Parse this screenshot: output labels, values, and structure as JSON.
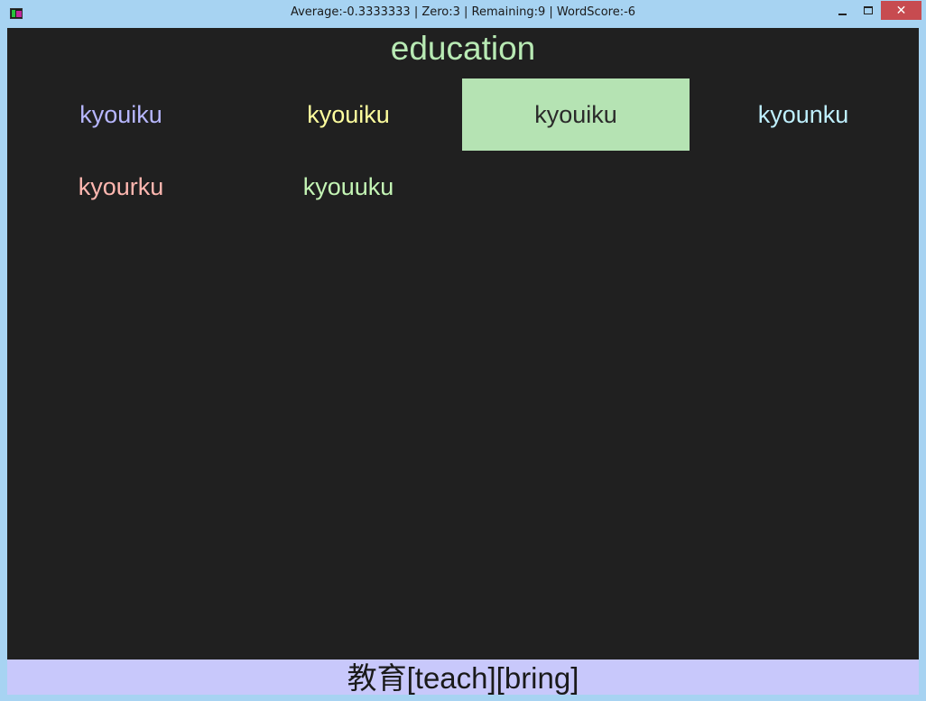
{
  "window": {
    "title": "Average:-0.3333333 | Zero:3 | Remaining:9 | WordScore:-6",
    "close_symbol": "✕"
  },
  "quiz": {
    "prompt": "education",
    "choices": [
      {
        "label": "kyouiku",
        "color": "#b7b7ff"
      },
      {
        "label": "kyouiku",
        "color": "#ffff9e"
      },
      {
        "label": "kyouiku",
        "color": "#2a2a2a",
        "selected": true
      },
      {
        "label": "kyounku",
        "color": "#bff0ff"
      },
      {
        "label": "kyourku",
        "color": "#ffb7b0"
      },
      {
        "label": "kyouuku",
        "color": "#c4f5b5"
      }
    ],
    "hint": "教育[teach][bring]"
  },
  "colors": {
    "client_bg": "#202020",
    "prompt": "#b8eab4",
    "selected_bg": "#b5e3b3",
    "footer_bg": "#c8c8fb",
    "titlebar": "#a7d3f2",
    "close_button": "#c74b50"
  },
  "icons": [
    "app-icon",
    "minimize-icon",
    "maximize-icon",
    "close-icon"
  ]
}
